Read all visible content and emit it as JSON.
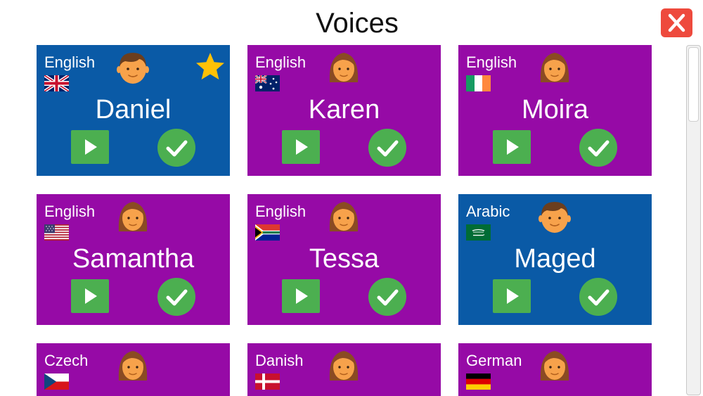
{
  "header": {
    "title": "Voices"
  },
  "icons": {
    "close": "close-icon",
    "play": "play-icon",
    "check": "check-icon",
    "favorite": "star-icon"
  },
  "colors": {
    "blue": "#0a5aa6",
    "purple": "#960aa6",
    "green": "#4caf50",
    "close_red": "#ee4a3d",
    "star": "#ffc107"
  },
  "voices": [
    {
      "language": "English",
      "name": "Daniel",
      "flag": "uk",
      "gender": "male",
      "favorite": true,
      "color": "blue"
    },
    {
      "language": "English",
      "name": "Karen",
      "flag": "australia",
      "gender": "female",
      "favorite": false,
      "color": "purple"
    },
    {
      "language": "English",
      "name": "Moira",
      "flag": "ireland",
      "gender": "female",
      "favorite": false,
      "color": "purple"
    },
    {
      "language": "English",
      "name": "Samantha",
      "flag": "usa",
      "gender": "female",
      "favorite": false,
      "color": "purple"
    },
    {
      "language": "English",
      "name": "Tessa",
      "flag": "south-africa",
      "gender": "female",
      "favorite": false,
      "color": "purple"
    },
    {
      "language": "Arabic",
      "name": "Maged",
      "flag": "saudi-arabia",
      "gender": "male",
      "favorite": false,
      "color": "blue"
    },
    {
      "language": "Czech",
      "name": "",
      "flag": "czech",
      "gender": "female",
      "favorite": false,
      "color": "purple"
    },
    {
      "language": "Danish",
      "name": "",
      "flag": "denmark",
      "gender": "female",
      "favorite": false,
      "color": "purple"
    },
    {
      "language": "German",
      "name": "",
      "flag": "germany",
      "gender": "female",
      "favorite": false,
      "color": "purple"
    }
  ]
}
